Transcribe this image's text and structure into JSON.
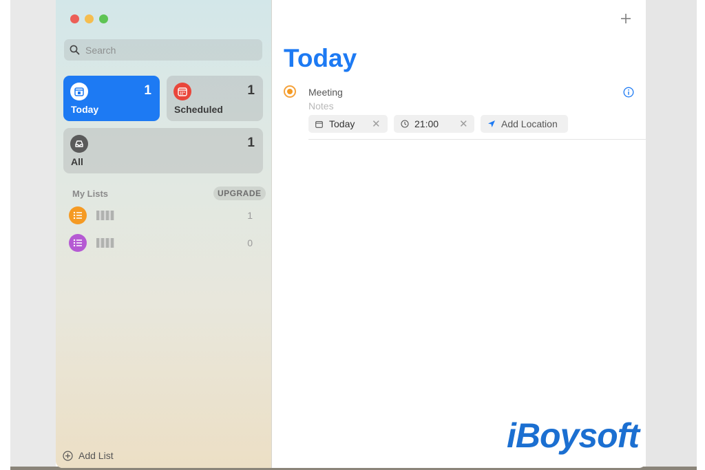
{
  "window": {
    "traffic_lights": {
      "close": "#ec5f57",
      "minimize": "#f5bd4f",
      "zoom": "#5ec454"
    }
  },
  "sidebar": {
    "search": {
      "placeholder": "Search"
    },
    "smart_lists": [
      {
        "label": "Today",
        "count": "1",
        "icon": "calendar-icon",
        "color": "#1d7af3",
        "active": true
      },
      {
        "label": "Scheduled",
        "count": "1",
        "icon": "calendar-grid-icon",
        "color": "#e9463b",
        "active": false
      },
      {
        "label": "All",
        "count": "1",
        "icon": "tray-icon",
        "color": "#5a5a5a",
        "active": false
      }
    ],
    "my_lists": {
      "title": "My Lists",
      "upgrade_label": "UPGRADE",
      "items": [
        {
          "count": "1",
          "icon": "list-icon",
          "color": "#f59a23"
        },
        {
          "count": "0",
          "icon": "list-icon",
          "color": "#b55ad3"
        }
      ]
    },
    "add_list_label": "Add List"
  },
  "main": {
    "add_icon": "plus-icon",
    "title": "Today",
    "accent_color": "#1d7af3",
    "task": {
      "title": "Meeting",
      "notes_placeholder": "Notes",
      "date_chip": "Today",
      "time_chip": "21:00",
      "location_chip": "Add Location"
    }
  },
  "watermark": "iBoysoft"
}
